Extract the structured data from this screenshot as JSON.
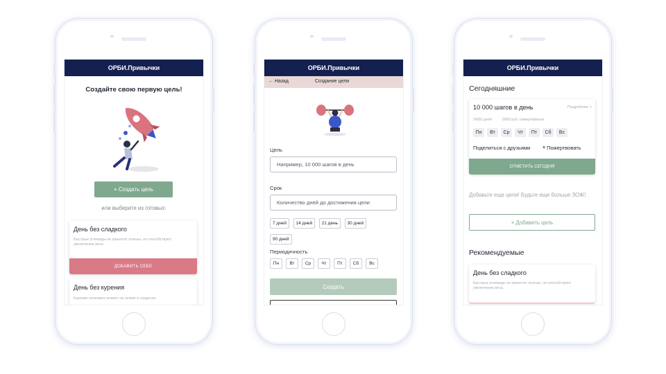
{
  "app_name": "ОРБИ.Привычки",
  "screen1": {
    "title": "Создайте свою первую цель!",
    "create_button": "+ Создать цель",
    "or_choose": "или выберите из готовых:",
    "cards": [
      {
        "title": "День без сладкого",
        "description": "Быстрые углеводы не приносят пользы, но способствуют увеличению веса.",
        "action": "ДОБАВИТЬ СЕБЕ"
      },
      {
        "title": "День без курения",
        "description": "Курение негативно влияет на легкие и сердечно"
      }
    ]
  },
  "screen2": {
    "back": "← Назад",
    "header_title": "Создание цели",
    "goal_label": "Цель",
    "goal_placeholder": "Например, 10 000 шагов в день",
    "term_label": "Срок",
    "term_placeholder": "Количество дней до достижения цели",
    "term_chips": [
      "7 дней",
      "14 дней",
      "21 день",
      "30 дней",
      "90 дней"
    ],
    "period_label": "Периодичность",
    "days": [
      "Пн",
      "Вт",
      "Ср",
      "Чт",
      "Пт",
      "Сб",
      "Вс"
    ],
    "create_button": "Создать"
  },
  "screen3": {
    "today_title": "Сегодняшние",
    "goal": {
      "title": "10 000 шагов в день",
      "more": "Подробнее >",
      "progress": "24/50 дней",
      "donated": "5000 руб. пожертвовали",
      "days": [
        "Пн",
        "Вт",
        "Ср",
        "Чт",
        "Пт",
        "Сб",
        "Вс"
      ],
      "share": "Поделиться с друзьями",
      "donate": "Пожертвовать",
      "mark_button": "ОТМЕТИТЬ СЕГОДНЯ"
    },
    "add_more_text": "Добавьте еще цели! Будьте еще больше ЗОЖ!",
    "add_button": "+ Добавить цель",
    "recommended_title": "Рекомендуемые",
    "rec_card": {
      "title": "День без сладкого",
      "description": "Быстрые углеводы не приносят пользы, но способствуют увеличению веса."
    }
  },
  "colors": {
    "header": "#142050",
    "green": "#7fa88f",
    "green_light": "#b4cbbc",
    "pink": "#d97a86",
    "subheader": "#ead8d6"
  }
}
